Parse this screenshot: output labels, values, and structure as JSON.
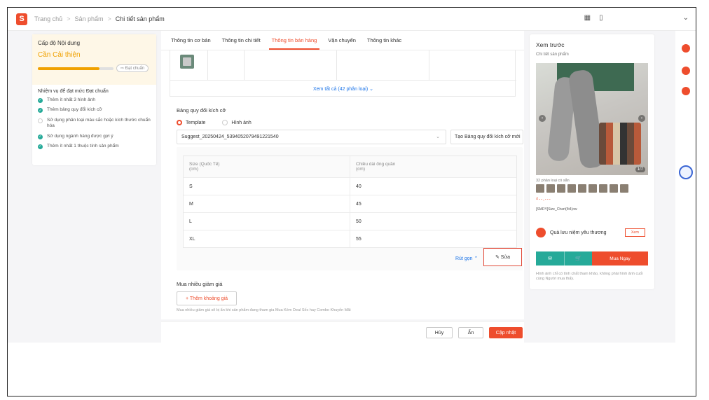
{
  "header": {
    "logo": "S",
    "breadcrumbs": [
      "Trang chủ",
      "Sản phẩm",
      "Chi tiết sản phẩm"
    ],
    "sep": ">",
    "icons": [
      "grid-icon",
      "book-icon",
      "chevron-down-icon"
    ]
  },
  "left": {
    "title": "Cấp độ Nội dung",
    "level": "Cần Cải thiện",
    "badge": "⇨ Đạt chuẩn",
    "progress_fraction": 0.82,
    "tasks_title": "Nhiệm vụ để đạt mức Đạt chuẩn",
    "tasks": [
      {
        "label": "Thêm ít nhất 3 hình ảnh",
        "done": true
      },
      {
        "label": "Thêm bảng quy đổi kích cỡ",
        "done": true
      },
      {
        "label": "Sử dụng phân loại màu sắc hoặc kích thước chuẩn hóa",
        "done": false
      },
      {
        "label": "Sử dụng ngành hàng được gợi ý",
        "done": true
      },
      {
        "label": "Thêm ít nhất 1 thuộc tính sản phẩm",
        "done": true
      }
    ]
  },
  "tabs": [
    "Thông tin cơ bản",
    "Thông tin chi tiết",
    "Thông tin bán hàng",
    "Vận chuyển",
    "Thông tin khác"
  ],
  "active_tab": "Thông tin bán hàng",
  "variants": {
    "see_all": "Xem tất cả (42 phân loại) ⌄"
  },
  "size_chart": {
    "title": "Bảng quy đổi kích cỡ",
    "radio_template": "Template",
    "radio_image": "Hình ảnh",
    "selected": "Suggest_20250424_5394052079491221540",
    "create_button": "Tạo Bảng quy đổi kích cỡ mới",
    "col1": "Size (Quốc Tế)",
    "col1_unit": "(cm)",
    "col2": "Chiều dài ống quần",
    "col2_unit": "(cm)",
    "rows": [
      [
        "S",
        "40"
      ],
      [
        "M",
        "45"
      ],
      [
        "L",
        "50"
      ],
      [
        "XL",
        "55"
      ]
    ],
    "collapse": "Rút gọn ⌃",
    "edit": "✎ Sửa"
  },
  "bulk_discount": {
    "title": "Mua nhiều giảm giá",
    "add": "+ Thêm khoảng giá",
    "note": "Mua nhiều giảm giá sẽ bị ẩn khi sản phẩm đang tham gia Mua Kèm Deal Sốc hay Combo Khuyến Mãi"
  },
  "footer": {
    "cancel": "Hủy",
    "hide": "Ẩn",
    "update": "Cập nhật"
  },
  "preview": {
    "title": "Xem trước",
    "subtitle": "Chi tiết sản phẩm",
    "counter": "1/7",
    "variants": "32 phân loại có sẵn",
    "price": "₫--,---",
    "size_chart_label": "[SMDY]Size_Chart(5t4)ow",
    "gift": "Quà lưu niệm yêu thương",
    "gift_view": "Xem",
    "buy_now": "Mua Ngay",
    "chat_icon": "chat-icon",
    "cart_icon": "cart-icon",
    "note": "Hình ảnh chỉ có tính chất tham khảo, không phải hình ảnh cuối cùng Người mua thấy."
  },
  "colors": {
    "brand": "#ee4d2d",
    "accent": "#f0a100",
    "ok": "#26aa99",
    "link": "#1a73e8"
  }
}
